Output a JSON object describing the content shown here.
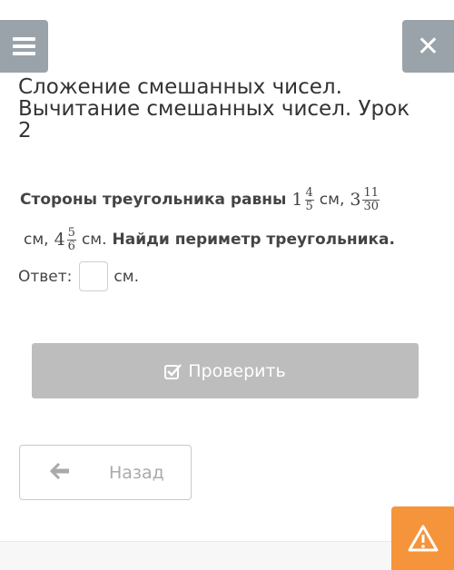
{
  "lesson": {
    "title": "Сложение смешанных чисел. Вычитание смешанных чисел. Урок 2"
  },
  "task": {
    "prefix": "Стороны треугольника равны",
    "sides": [
      {
        "whole": "1",
        "num": "4",
        "den": "5"
      },
      {
        "whole": "3",
        "num": "11",
        "den": "30"
      },
      {
        "whole": "4",
        "num": "5",
        "den": "6"
      }
    ],
    "unit": "см,",
    "unit_end": "см.",
    "question": "Найди периметр треугольника."
  },
  "answer": {
    "label": "Ответ:",
    "value": "",
    "unit": "см."
  },
  "buttons": {
    "check": "Проверить",
    "back": "Назад"
  },
  "icons": {
    "menu": "hamburger-icon",
    "close": "close-icon",
    "check": "checkbox-checked-icon",
    "back": "arrow-left-icon",
    "warning": "warning-triangle-icon"
  },
  "colors": {
    "nav_buttons": "#9aa3a9",
    "check_button": "#bdbdbd",
    "warning": "#f5943a"
  }
}
